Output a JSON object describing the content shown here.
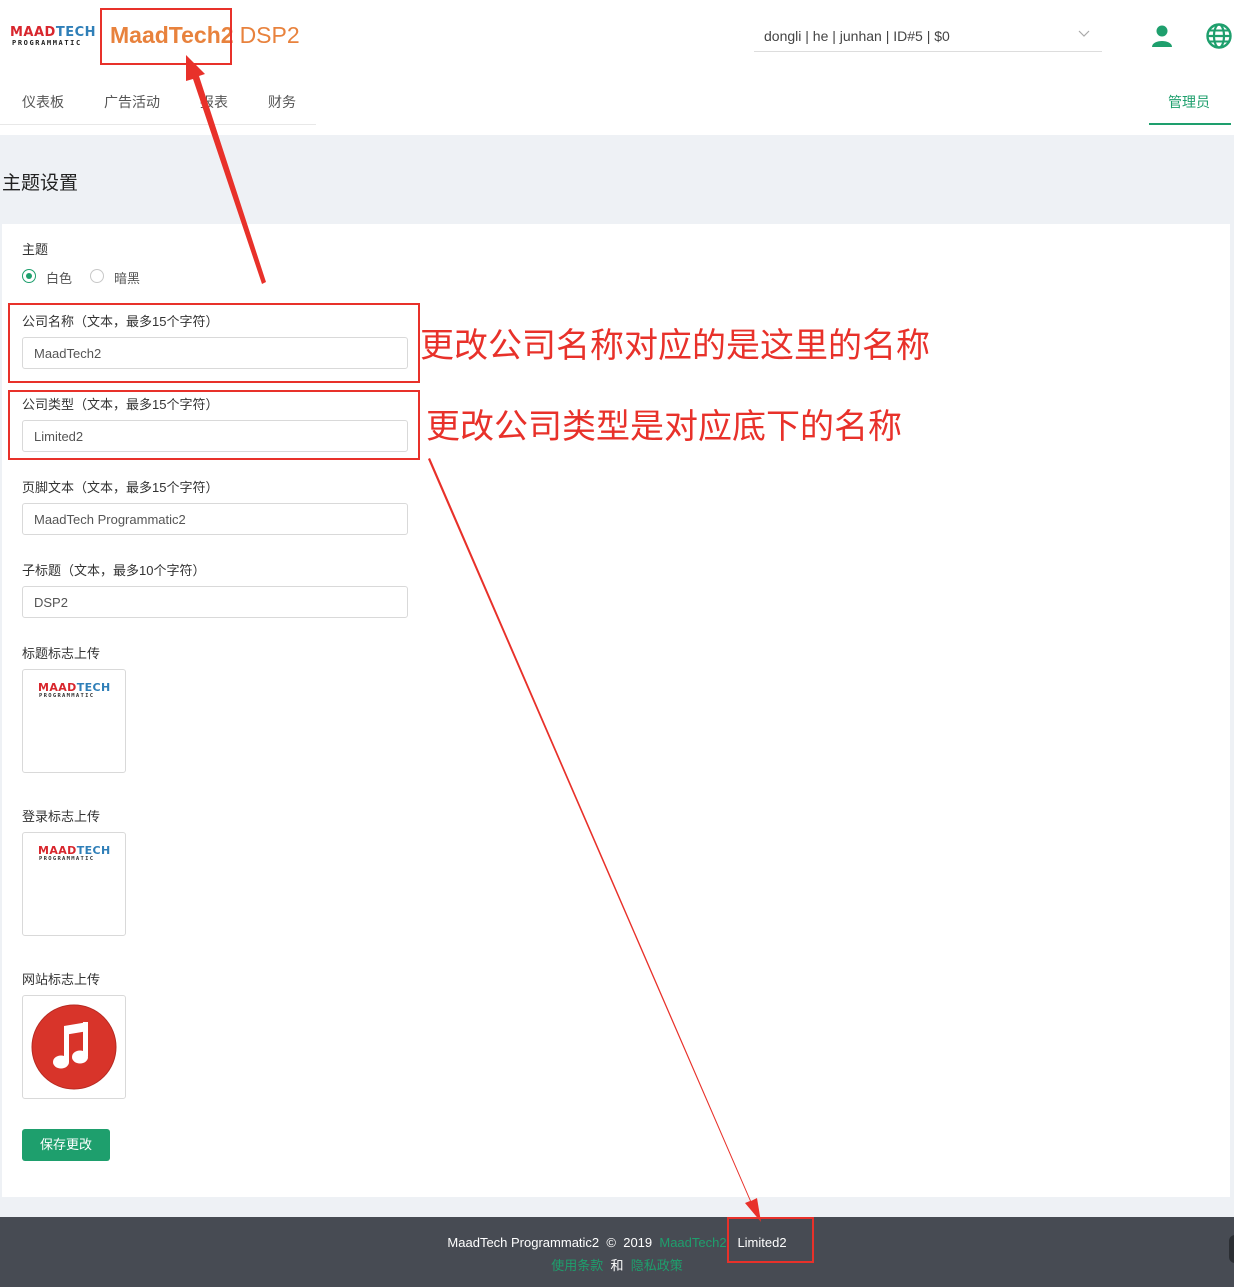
{
  "header": {
    "logo_top_a": "MAAD",
    "logo_top_b": "TECH",
    "logo_bottom": "PROGRAMMATIC",
    "brand_name": "MaadTech2",
    "brand_sub": "DSP2",
    "user_select_value": "dongli | he | junhan | ID#5 | $0"
  },
  "nav": {
    "items": [
      "仪表板",
      "广告活动",
      "报表",
      "财务"
    ],
    "admin": "管理员"
  },
  "page_title": "主题设置",
  "form": {
    "theme_label": "主题",
    "theme_options": [
      "白色",
      "暗黑"
    ],
    "theme_selected": "白色",
    "company_name_label": "公司名称（文本，最多15个字符）",
    "company_name_value": "MaadTech2",
    "company_type_label": "公司类型（文本，最多15个字符）",
    "company_type_value": "Limited2",
    "footer_text_label": "页脚文本（文本，最多15个字符）",
    "footer_text_value": "MaadTech Programmatic2",
    "subtitle_label": "子标题（文本，最多10个字符）",
    "subtitle_value": "DSP2",
    "title_logo_label": "标题标志上传",
    "login_logo_label": "登录标志上传",
    "site_logo_label": "网站标志上传",
    "save_button": "保存更改"
  },
  "footer": {
    "text": "MaadTech Programmatic2",
    "copyright": "©",
    "year": "2019",
    "company_name": "MaadTech2",
    "company_type": "Limited2",
    "terms": "使用条款",
    "and": "和",
    "privacy": "隐私政策"
  },
  "annotations": {
    "name_note": "更改公司名称对应的是这里的名称",
    "type_note": "更改公司类型是对应底下的名称"
  },
  "colors": {
    "accent": "#1e9f6d",
    "brand": "#e8823d",
    "annotation": "#e8312a",
    "footer_bg": "#474b53"
  }
}
